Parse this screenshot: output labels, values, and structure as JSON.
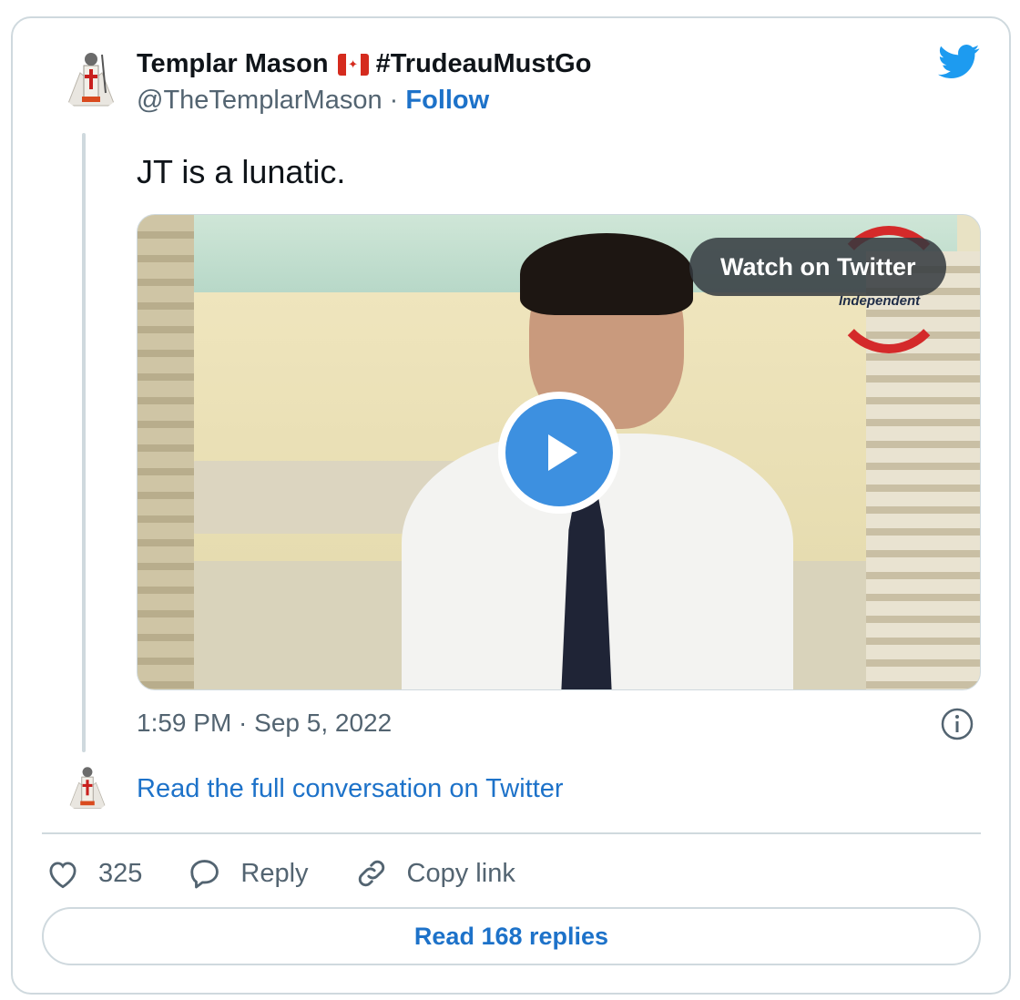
{
  "author": {
    "display_name": "Templar Mason",
    "flag_icon": "canada-flag-icon",
    "hashtag": "#TrudeauMustGo",
    "handle": "@TheTemplarMason",
    "separator": " · ",
    "follow_label": "Follow"
  },
  "tweet": {
    "text": "JT is a lunatic.",
    "timestamp": "1:59 PM · Sep 5, 2022"
  },
  "media": {
    "watch_label": "Watch on Twitter",
    "watermark_text": "Independent"
  },
  "conversation_link": "Read the full conversation on Twitter",
  "actions": {
    "like_count": "325",
    "reply_label": "Reply",
    "copy_link_label": "Copy link"
  },
  "read_replies_label": "Read 168 replies",
  "colors": {
    "link_blue": "#1d72c9",
    "twitter_blue": "#1d9bf0",
    "text_gray": "#536471",
    "border": "#cfd9de"
  }
}
